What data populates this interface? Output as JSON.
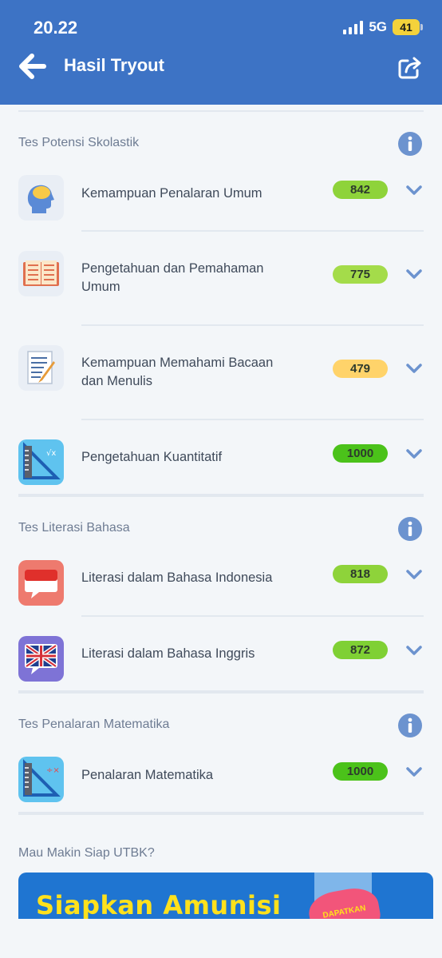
{
  "status_bar": {
    "time": "20.22",
    "network": "5G",
    "battery": "41"
  },
  "header": {
    "title": "Hasil Tryout"
  },
  "sections": [
    {
      "title": "Tes Potensi Skolastik",
      "items": [
        {
          "label": "Kemampuan Penalaran Umum",
          "score": "842",
          "score_color": "#8ed33a"
        },
        {
          "label": "Pengetahuan dan Pemahaman Umum",
          "score": "775",
          "score_color": "#a4dc4a"
        },
        {
          "label": "Kemampuan Memahami Bacaan dan Menulis",
          "score": "479",
          "score_color": "#ffd36a"
        },
        {
          "label": "Pengetahuan Kuantitatif",
          "score": "1000",
          "score_color": "#4bc21a"
        }
      ]
    },
    {
      "title": "Tes Literasi Bahasa",
      "items": [
        {
          "label": "Literasi dalam Bahasa Indonesia",
          "score": "818",
          "score_color": "#8ed33a"
        },
        {
          "label": "Literasi dalam Bahasa Inggris",
          "score": "872",
          "score_color": "#7fd034"
        }
      ]
    },
    {
      "title": "Tes Penalaran Matematika",
      "items": [
        {
          "label": "Penalaran Matematika",
          "score": "1000",
          "score_color": "#4bc21a"
        }
      ]
    }
  ],
  "promo": {
    "title": "Mau Makin Siap UTBK?",
    "banner_text": "Siapkan Amunisi",
    "badge_text": "DAPATKAN"
  },
  "colors": {
    "header": "#3d73c5",
    "accent_icon": "#6c93cf",
    "background": "#f3f6f9"
  }
}
